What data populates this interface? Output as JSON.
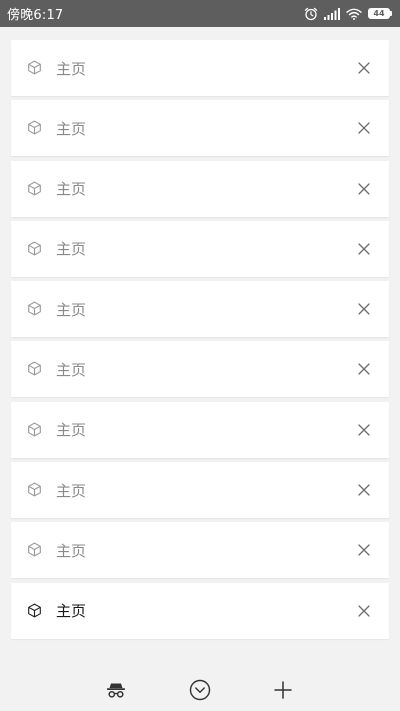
{
  "status_bar": {
    "time": "傍晚6:17",
    "battery_level": "44",
    "icons": [
      "alarm-icon",
      "signal-icon",
      "wifi-icon",
      "battery-icon"
    ]
  },
  "tabs": [
    {
      "title": "主页",
      "icon": "cube-icon",
      "active": false
    },
    {
      "title": "主页",
      "icon": "cube-icon",
      "active": false
    },
    {
      "title": "主页",
      "icon": "cube-icon",
      "active": false
    },
    {
      "title": "主页",
      "icon": "cube-icon",
      "active": false
    },
    {
      "title": "主页",
      "icon": "cube-icon",
      "active": false
    },
    {
      "title": "主页",
      "icon": "cube-icon",
      "active": false
    },
    {
      "title": "主页",
      "icon": "cube-icon",
      "active": false
    },
    {
      "title": "主页",
      "icon": "cube-icon",
      "active": false
    },
    {
      "title": "主页",
      "icon": "cube-icon",
      "active": false
    },
    {
      "title": "主页",
      "icon": "cube-icon",
      "active": true
    }
  ],
  "bottom_bar": {
    "buttons": [
      "incognito-icon",
      "collapse-icon",
      "add-tab-icon"
    ]
  },
  "colors": {
    "status_bar_bg": "#5e5e5e",
    "page_bg": "#f2f2f2",
    "card_bg": "#ffffff",
    "inactive_text": "#8a8a8a",
    "active_text": "#1a1a1a"
  }
}
